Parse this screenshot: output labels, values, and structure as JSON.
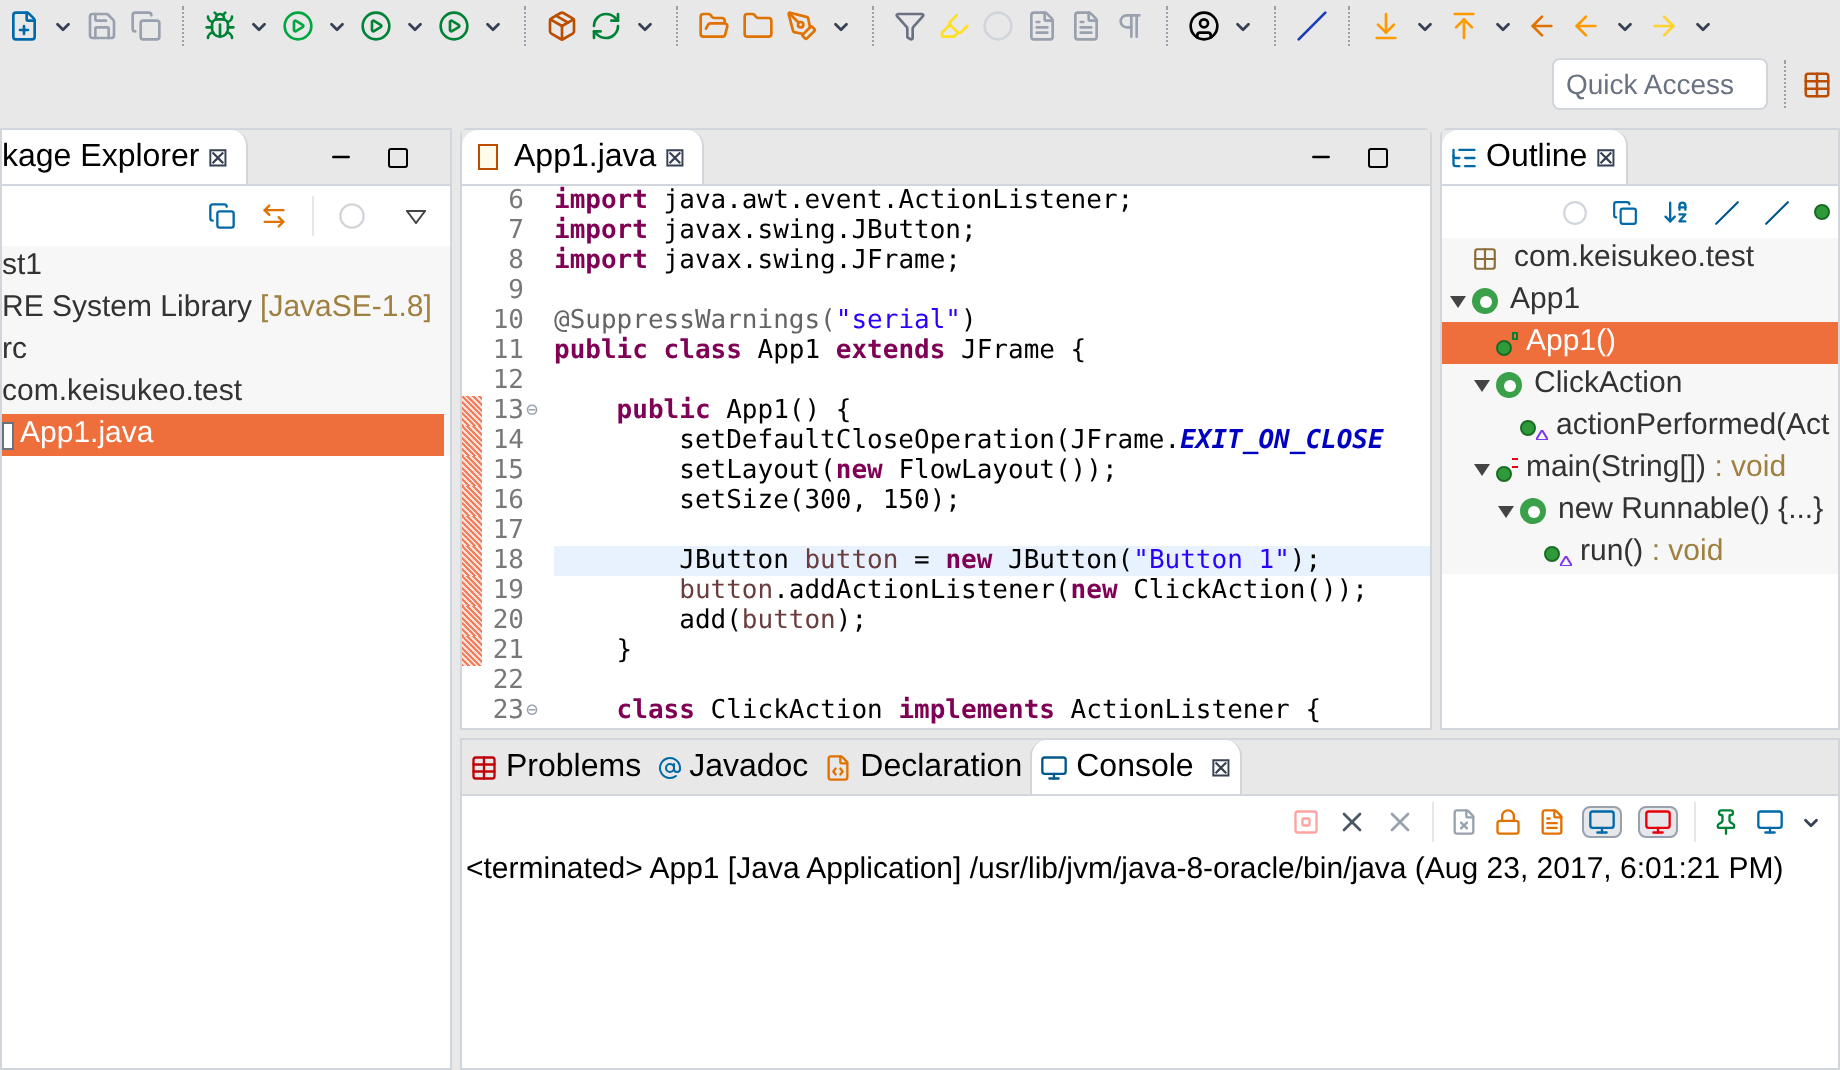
{
  "quick_access": {
    "placeholder": "Quick Access"
  },
  "package_explorer": {
    "tab": {
      "label": "kage Explorer",
      "close": "⊠"
    },
    "tree": [
      {
        "label": "st1",
        "children": [
          {
            "label": "RE System Library",
            "decoration": "[JavaSE-1.8]",
            "selected": false
          },
          {
            "label": "rc",
            "children": [
              {
                "label": "com.keisukeo.test",
                "children": [
                  {
                    "label": "App1.java",
                    "selected": true
                  }
                ]
              }
            ]
          }
        ]
      }
    ]
  },
  "editor": {
    "tab": {
      "label": "App1.java",
      "close": "⊠"
    },
    "lines": [
      {
        "number": "6",
        "changed": false,
        "current": false,
        "tokens": [
          {
            "kind": "kw",
            "text": "import"
          },
          {
            "kind": "plain",
            "text": " java.awt.event.ActionListener;"
          }
        ]
      },
      {
        "number": "7",
        "changed": false,
        "current": false,
        "tokens": [
          {
            "kind": "kw",
            "text": "import"
          },
          {
            "kind": "plain",
            "text": " javax.swing.JButton;"
          }
        ]
      },
      {
        "number": "8",
        "changed": false,
        "current": false,
        "tokens": [
          {
            "kind": "kw",
            "text": "import"
          },
          {
            "kind": "plain",
            "text": " javax.swing.JFrame;"
          }
        ]
      },
      {
        "number": "9",
        "changed": false,
        "current": false
      },
      {
        "number": "10",
        "changed": false,
        "current": false,
        "tokens": [
          {
            "kind": "ann",
            "text": "@SuppressWarnings("
          },
          {
            "kind": "str",
            "text": "\"serial\""
          },
          {
            "kind": "plain",
            "text": ")"
          }
        ]
      },
      {
        "number": "11",
        "changed": false,
        "current": false,
        "tokens": [
          {
            "kind": "kw",
            "text": "public class"
          },
          {
            "kind": "plain",
            "text": " App1 "
          },
          {
            "kind": "kw",
            "text": "extends"
          },
          {
            "kind": "plain",
            "text": " JFrame {"
          }
        ]
      },
      {
        "number": "12",
        "changed": false,
        "current": false
      },
      {
        "number": "13",
        "changed": true,
        "current": false,
        "fold": "⊖",
        "tokens": [
          {
            "kind": "kw",
            "text": "    public"
          },
          {
            "kind": "plain",
            "text": " App1() {"
          }
        ]
      },
      {
        "number": "14",
        "changed": true,
        "current": false,
        "tokens": [
          {
            "kind": "plain",
            "text": "        setDefaultCloseOperation(JFrame."
          },
          {
            "kind": "field",
            "text": "EXIT_ON_CLOSE"
          }
        ]
      },
      {
        "number": "15",
        "changed": true,
        "current": false,
        "tokens": [
          {
            "kind": "plain",
            "text": "        setLayout("
          },
          {
            "kind": "kw",
            "text": "new"
          },
          {
            "kind": "plain",
            "text": " FlowLayout());"
          }
        ]
      },
      {
        "number": "16",
        "changed": true,
        "current": false,
        "tokens": [
          {
            "kind": "plain",
            "text": "        setSize(300, 150);"
          }
        ]
      },
      {
        "number": "17",
        "changed": true,
        "current": false
      },
      {
        "number": "18",
        "changed": true,
        "current": true,
        "tokens": [
          {
            "kind": "plain",
            "text": "        JButton "
          },
          {
            "kind": "var",
            "text": "button"
          },
          {
            "kind": "plain",
            "text": " = "
          },
          {
            "kind": "kw",
            "text": "new"
          },
          {
            "kind": "plain",
            "text": " JButton("
          },
          {
            "kind": "str",
            "text": "\"Button 1\""
          },
          {
            "kind": "plain",
            "text": ");"
          }
        ]
      },
      {
        "number": "19",
        "changed": true,
        "current": false,
        "tokens": [
          {
            "kind": "var",
            "text": "        button"
          },
          {
            "kind": "plain",
            "text": ".addActionListener("
          },
          {
            "kind": "kw",
            "text": "new"
          },
          {
            "kind": "plain",
            "text": " ClickAction());"
          }
        ]
      },
      {
        "number": "20",
        "changed": true,
        "current": false,
        "tokens": [
          {
            "kind": "plain",
            "text": "        add("
          },
          {
            "kind": "var",
            "text": "button"
          },
          {
            "kind": "plain",
            "text": ");"
          }
        ]
      },
      {
        "number": "21",
        "changed": true,
        "current": false,
        "tokens": [
          {
            "kind": "plain",
            "text": "    }"
          }
        ]
      },
      {
        "number": "22",
        "changed": false,
        "current": false
      },
      {
        "number": "23",
        "changed": false,
        "current": false,
        "fold": "⊖",
        "tokens": [
          {
            "kind": "kw",
            "text": "    class"
          },
          {
            "kind": "plain",
            "text": " ClickAction "
          },
          {
            "kind": "kw",
            "text": "implements"
          },
          {
            "kind": "plain",
            "text": " ActionListener {"
          }
        ]
      }
    ]
  },
  "outline": {
    "tab": {
      "label": "Outline",
      "close": "⊠"
    },
    "tree": [
      {
        "kind": "package",
        "label": "com.keisukeo.test",
        "selected": false
      },
      {
        "kind": "class",
        "label": "App1",
        "expanded": true,
        "selected": false,
        "children": [
          {
            "kind": "constructor",
            "label": "App1()",
            "selected": true
          },
          {
            "kind": "class",
            "label": "ClickAction",
            "expanded": true,
            "selected": false,
            "children": [
              {
                "kind": "method",
                "label": "actionPerformed(Act",
                "selected": false
              }
            ]
          },
          {
            "kind": "static_method",
            "label": "main(String[])",
            "return_type": " : void",
            "expanded": true,
            "selected": false,
            "children": [
              {
                "kind": "class",
                "label": "new Runnable() {...}",
                "expanded": true,
                "selected": false,
                "children": [
                  {
                    "kind": "method",
                    "label": "run()",
                    "return_type": " : void",
                    "selected": false
                  }
                ]
              }
            ]
          }
        ]
      }
    ]
  },
  "bottom": {
    "tabs": [
      {
        "label": "Problems",
        "selected": false
      },
      {
        "label": "Javadoc",
        "selected": false
      },
      {
        "label": "Declaration",
        "selected": false
      },
      {
        "label": "Console",
        "selected": true,
        "close": "⊠"
      }
    ],
    "console": {
      "status": "<terminated> App1 [Java Application] /usr/lib/jvm/java-8-oracle/bin/java (Aug 23, 2017, 6:01:21 PM)"
    }
  }
}
